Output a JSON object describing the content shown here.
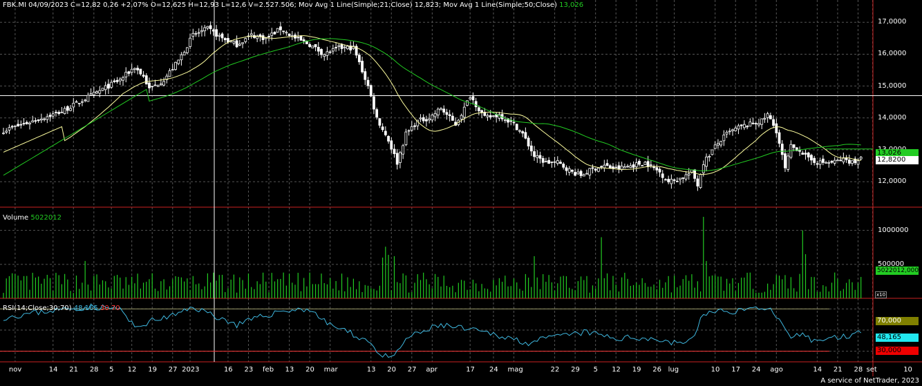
{
  "header": {
    "symbol_line": "FBK.MI 04/09/2023 C=12,82 0,26 +2,07% O=12,625 H=12,93 L=12,6 V=2.527.506; Mov Avg 1 Line(Simple;21;Close) 12,823; Mov Avg 1 Line(Simple;50;Close)",
    "ma50_value": "13,026"
  },
  "volume_panel": {
    "label": "Volume",
    "value": "5022012",
    "scale_tag": "x10"
  },
  "rsi_panel": {
    "label": "RSI(14;Close;30;70)",
    "value": "48,165",
    "low": "30",
    "high": "70"
  },
  "price_tags": {
    "ma50": "13,026",
    "close": "12,8200"
  },
  "volume_tag": "5022012,000",
  "rsi_tags": {
    "upper": "70,000",
    "value": "48,165",
    "lower": "30,000"
  },
  "footer": "A service of NetTrader, 2023",
  "colors": {
    "candle": "#ffffff",
    "ma21": "#ffffa0",
    "ma50": "#22cc22",
    "volume": "#22cc22",
    "rsi": "#3fb8e0",
    "grid": "#555555",
    "axis": "#cc2222"
  },
  "chart_data": [
    {
      "type": "candlestick",
      "title": "FBK.MI",
      "y_ticks": [
        "12,0000",
        "13,0000",
        "14,0000",
        "15,0000",
        "16,0000",
        "17,0000"
      ],
      "y_tick_values": [
        12,
        13,
        14,
        15,
        16,
        17
      ],
      "ylim": [
        11.2,
        17.7
      ],
      "reference_line": 14.7,
      "x_ticks": [
        "nov",
        "14",
        "21",
        "28",
        "5",
        "12",
        "19",
        "27",
        "2023",
        "16",
        "23",
        "feb",
        "13",
        "20",
        "mar",
        "13",
        "20",
        "27",
        "apr",
        "17",
        "24",
        "mag",
        "22",
        "29",
        "5",
        "12",
        "19",
        "26",
        "lug",
        "10",
        "17",
        "24",
        "ago",
        "14",
        "21",
        "28",
        "set",
        "10"
      ],
      "keypoints": [
        [
          0,
          13.6
        ],
        [
          10,
          13.9
        ],
        [
          20,
          14.2
        ],
        [
          30,
          14.7
        ],
        [
          40,
          15.2
        ],
        [
          45,
          15.6
        ],
        [
          48,
          15.3
        ],
        [
          50,
          14.9
        ],
        [
          55,
          15.2
        ],
        [
          60,
          15.8
        ],
        [
          65,
          16.6
        ],
        [
          70,
          16.8
        ],
        [
          75,
          16.5
        ],
        [
          80,
          16.3
        ],
        [
          85,
          16.6
        ],
        [
          90,
          16.5
        ],
        [
          95,
          16.8
        ],
        [
          100,
          16.5
        ],
        [
          105,
          16.3
        ],
        [
          110,
          16.0
        ],
        [
          115,
          16.2
        ],
        [
          120,
          16.2
        ],
        [
          125,
          15.0
        ],
        [
          128,
          14.0
        ],
        [
          132,
          13.3
        ],
        [
          135,
          12.6
        ],
        [
          138,
          13.5
        ],
        [
          142,
          13.9
        ],
        [
          146,
          14.0
        ],
        [
          150,
          14.3
        ],
        [
          155,
          13.8
        ],
        [
          158,
          14.3
        ],
        [
          160,
          14.7
        ],
        [
          165,
          14.0
        ],
        [
          170,
          14.1
        ],
        [
          175,
          13.8
        ],
        [
          178,
          13.5
        ],
        [
          182,
          12.8
        ],
        [
          186,
          12.6
        ],
        [
          190,
          12.6
        ],
        [
          195,
          12.3
        ],
        [
          198,
          12.2
        ],
        [
          202,
          12.4
        ],
        [
          206,
          12.5
        ],
        [
          210,
          12.4
        ],
        [
          215,
          12.5
        ],
        [
          220,
          12.6
        ],
        [
          225,
          12.3
        ],
        [
          228,
          12.0
        ],
        [
          232,
          12.1
        ],
        [
          236,
          12.3
        ],
        [
          238,
          11.9
        ],
        [
          240,
          12.6
        ],
        [
          244,
          13.1
        ],
        [
          248,
          13.5
        ],
        [
          252,
          13.7
        ],
        [
          256,
          13.8
        ],
        [
          260,
          13.9
        ],
        [
          262,
          14.1
        ],
        [
          265,
          13.6
        ],
        [
          268,
          12.4
        ],
        [
          270,
          13.1
        ],
        [
          273,
          13.0
        ],
        [
          276,
          12.7
        ],
        [
          280,
          12.6
        ],
        [
          284,
          12.6
        ],
        [
          288,
          12.7
        ],
        [
          292,
          12.6
        ],
        [
          294,
          12.8
        ]
      ],
      "series": [
        {
          "name": "Mov Avg 1 Line(Simple;21;Close)",
          "last": 12.823
        },
        {
          "name": "Mov Avg 1 Line(Simple;50;Close)",
          "last": 13.026
        }
      ],
      "last_close": 12.82
    },
    {
      "type": "bar",
      "title": "Volume",
      "y_ticks": [
        "500000",
        "1000000"
      ],
      "y_tick_values": [
        500000,
        1000000
      ],
      "ylim": [
        0,
        1200000
      ],
      "last": 5022012,
      "spikes": [
        [
          28,
          550000
        ],
        [
          130,
          600000
        ],
        [
          131,
          760000
        ],
        [
          132,
          640000
        ],
        [
          134,
          620000
        ],
        [
          182,
          620000
        ],
        [
          205,
          900000
        ],
        [
          240,
          1200000
        ],
        [
          241,
          550000
        ],
        [
          274,
          1000000
        ],
        [
          275,
          650000
        ]
      ]
    },
    {
      "type": "line",
      "title": "RSI(14;Close;30;70)",
      "y_ticks": [
        "30,000",
        "70,000"
      ],
      "y_tick_values": [
        30,
        70
      ],
      "ylim": [
        20,
        80
      ],
      "last": 48.165,
      "keypoints": [
        [
          0,
          62
        ],
        [
          15,
          68
        ],
        [
          30,
          72
        ],
        [
          40,
          70
        ],
        [
          45,
          52
        ],
        [
          50,
          58
        ],
        [
          60,
          65
        ],
        [
          65,
          72
        ],
        [
          72,
          64
        ],
        [
          80,
          55
        ],
        [
          88,
          62
        ],
        [
          95,
          68
        ],
        [
          105,
          70
        ],
        [
          110,
          58
        ],
        [
          118,
          48
        ],
        [
          125,
          40
        ],
        [
          130,
          25
        ],
        [
          134,
          24
        ],
        [
          138,
          42
        ],
        [
          150,
          55
        ],
        [
          160,
          50
        ],
        [
          170,
          45
        ],
        [
          180,
          38
        ],
        [
          190,
          44
        ],
        [
          200,
          48
        ],
        [
          210,
          42
        ],
        [
          220,
          43
        ],
        [
          230,
          38
        ],
        [
          236,
          40
        ],
        [
          240,
          66
        ],
        [
          250,
          68
        ],
        [
          262,
          72
        ],
        [
          266,
          58
        ],
        [
          270,
          40
        ],
        [
          273,
          46
        ],
        [
          278,
          40
        ],
        [
          285,
          43
        ],
        [
          292,
          46
        ],
        [
          294,
          48.165
        ]
      ]
    }
  ]
}
